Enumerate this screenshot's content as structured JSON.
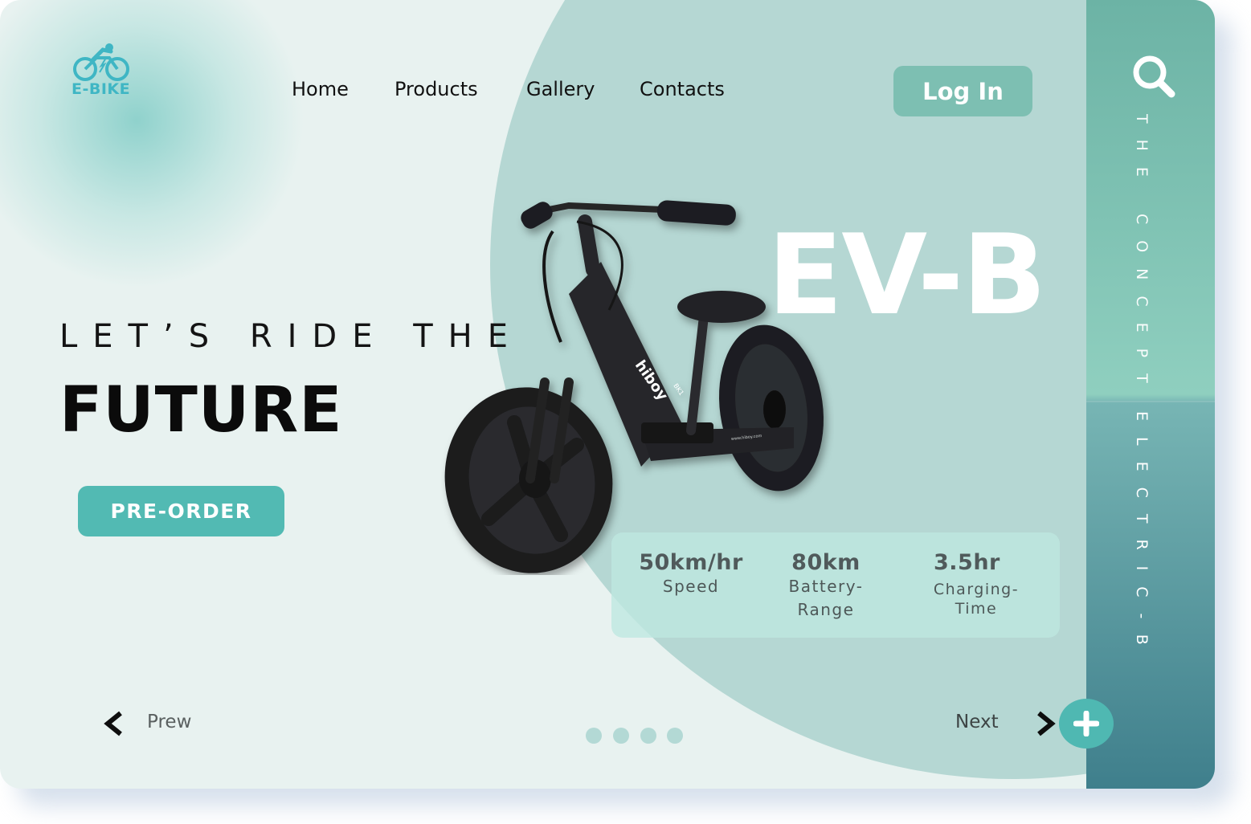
{
  "brand": {
    "name": "E-BIKE",
    "accent": "#3fb6c4"
  },
  "nav": {
    "items": [
      {
        "label": "Home"
      },
      {
        "label": "Products"
      },
      {
        "label": "Gallery"
      },
      {
        "label": "Contacts"
      }
    ],
    "login_label": "Log In"
  },
  "hero": {
    "line1": "LET’S RIDE THE",
    "line2": "FUTURE",
    "cta_label": "PRE-ORDER",
    "model": "EV-B",
    "bike_text": {
      "brand": "hiboy",
      "model_code": "BK1",
      "url": "www.hiboy.com"
    }
  },
  "specs": [
    {
      "value": "50km/hr",
      "label": "Speed"
    },
    {
      "value": "80km",
      "label": "Battery-Range"
    },
    {
      "value": "3.5hr",
      "label": "Charging-Time"
    }
  ],
  "sidebar": {
    "tagline_top": "THE CONCEPT",
    "tagline_bottom": "ELECTRIC-B",
    "icon": "search-icon"
  },
  "pagination": {
    "prev_label": "Prew",
    "next_label": "Next",
    "dot_count": 4
  },
  "colors": {
    "background": "#e8f2f0",
    "circle": "#b5d7d3",
    "button_primary": "#52bab3",
    "button_login": "#7dbfb2",
    "sidebar_top": "#6cb3a5",
    "sidebar_bottom": "#3f7f8c"
  }
}
